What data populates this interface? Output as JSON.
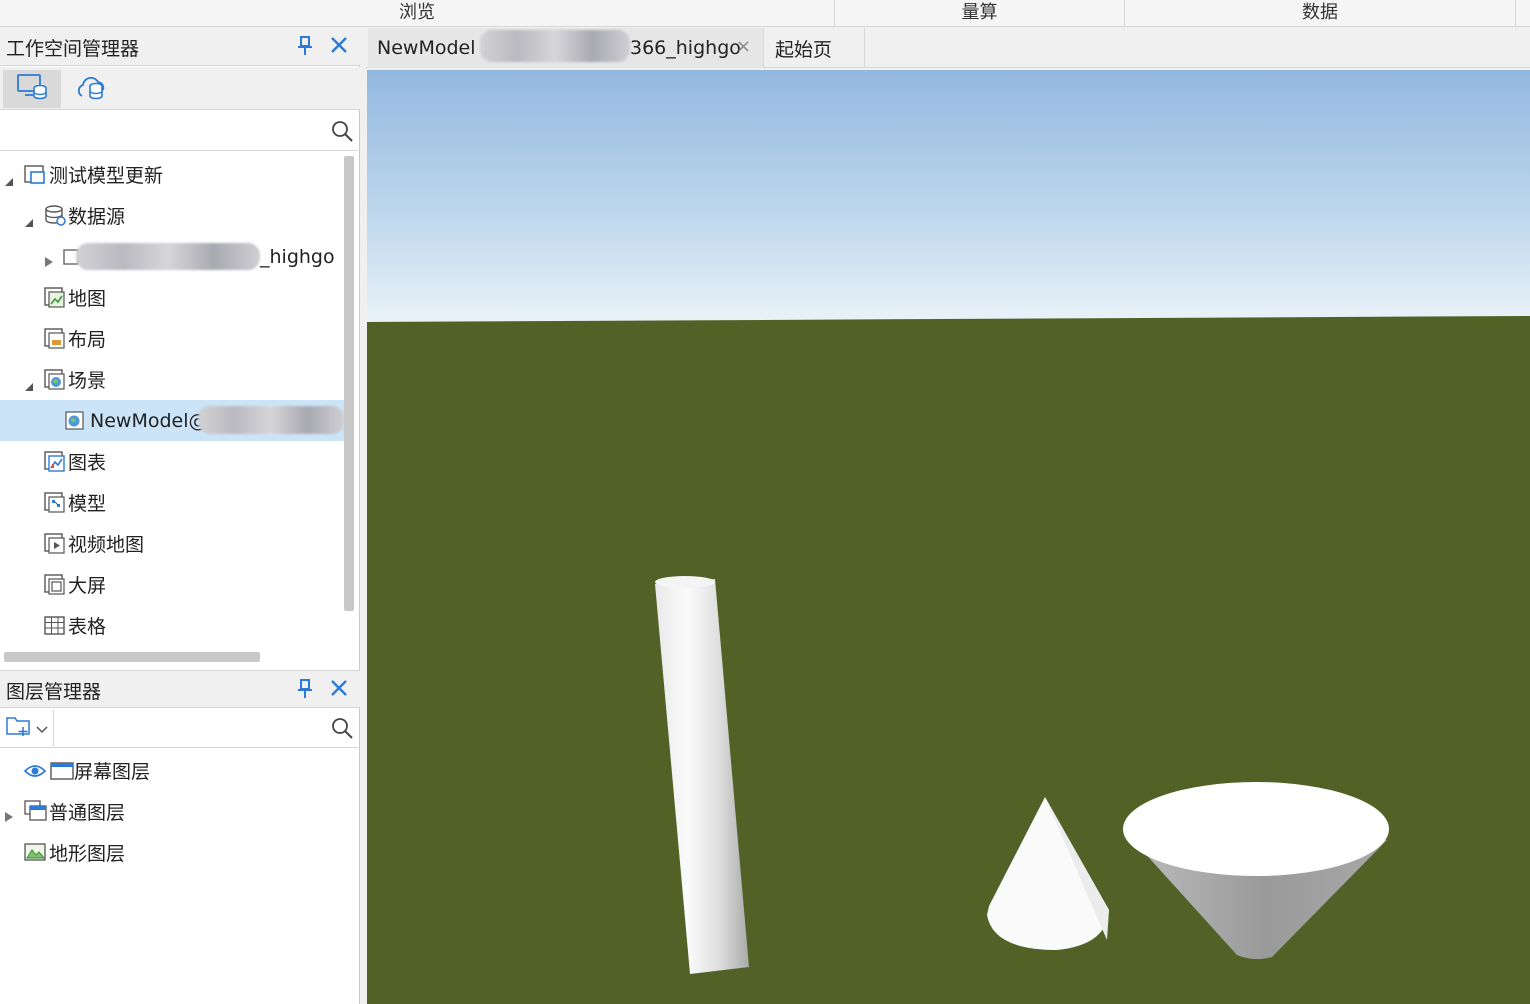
{
  "ribbon": {
    "groups": [
      "浏览",
      "量算",
      "数据"
    ]
  },
  "workspace_manager": {
    "title": "工作空间管理器",
    "tabs": [
      {
        "icon": "local-workspace-icon"
      },
      {
        "icon": "cloud-workspace-icon"
      }
    ],
    "search_placeholder": "",
    "tree": {
      "root": "测试模型更新",
      "datasources": "数据源",
      "datasource_item_suffix": "_highgo",
      "maps": "地图",
      "layouts": "布局",
      "scenes": "场景",
      "scene_item_prefix": "NewModel@",
      "charts": "图表",
      "models": "模型",
      "video_maps": "视频地图",
      "big_screens": "大屏",
      "tables": "表格"
    }
  },
  "layer_manager": {
    "title": "图层管理器",
    "search_placeholder": "",
    "layers": [
      "屏幕图层",
      "普通图层",
      "地形图层"
    ]
  },
  "document_tabs": {
    "scene_tab_prefix": "NewModel",
    "scene_tab_suffix": "366_highgo",
    "close_glyph": "×",
    "start_tab": "起始页"
  },
  "colors": {
    "accent": "#2b7bd6",
    "selection": "#cce4f7",
    "sky_top": "#93b8df",
    "sky_bottom": "#e9f2f8",
    "ground": "#526226"
  }
}
